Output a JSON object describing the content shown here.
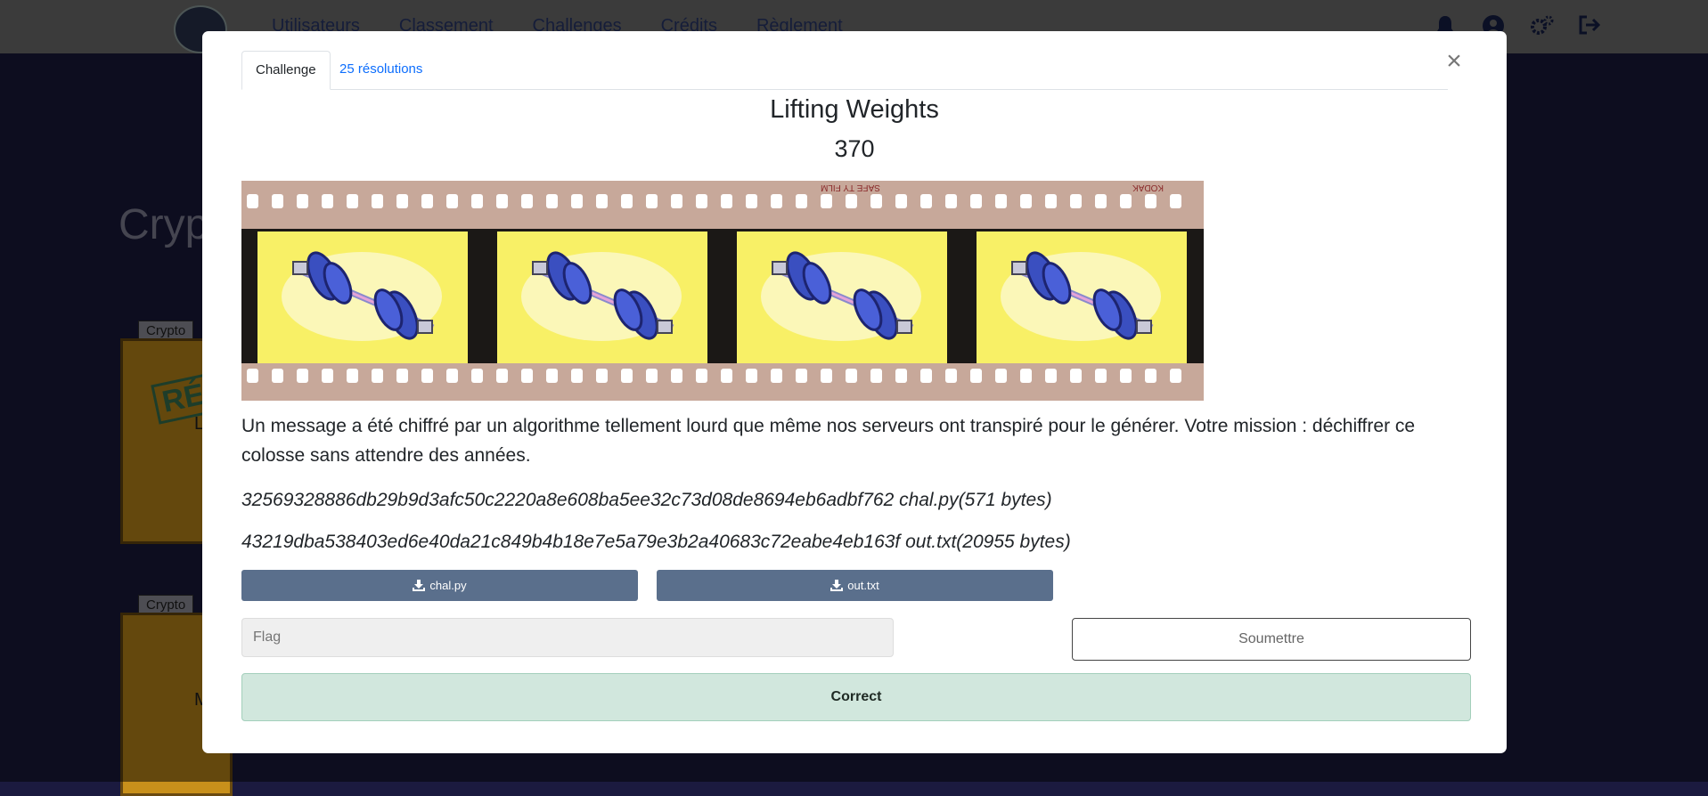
{
  "nav": {
    "links": [
      "Utilisateurs",
      "Classement",
      "Challenges",
      "Crédits",
      "Règlement"
    ],
    "icons": [
      "bell-icon",
      "user-icon",
      "settings-icon",
      "logout-icon"
    ]
  },
  "background": {
    "section_title": "Cryp",
    "cards": [
      {
        "tag": "Crypto",
        "stamp": "RÉS",
        "letter": "L"
      },
      {
        "tag": "Crypto",
        "letter": "M"
      }
    ]
  },
  "modal": {
    "tabs": {
      "challenge": "Challenge",
      "solves": "25 résolutions"
    },
    "title": "Lifting Weights",
    "points": "370",
    "description": "Un message a été chiffré par un algorithme tellement lourd que même nos serveurs ont transpiré pour le générer. Votre mission : déchiffrer ce colosse sans attendre des années.",
    "files": [
      {
        "hash_line": "32569328886db29b9d3afc50c2220a8e608ba5ee32c73d08de8694eb6adbf762 chal.py(571 bytes)",
        "button": "chal.py"
      },
      {
        "hash_line": "43219dba538403ed6e40da21c849b4b18e7e5a79e3b2a40683c72eabe4eb163f out.txt(20955 bytes)",
        "button": "out.txt"
      }
    ],
    "film_text": {
      "top_left": "SAFE TY FILM",
      "brand": "KODAK"
    },
    "flag_placeholder": "Flag",
    "submit_label": "Soumettre",
    "result": "Correct"
  }
}
